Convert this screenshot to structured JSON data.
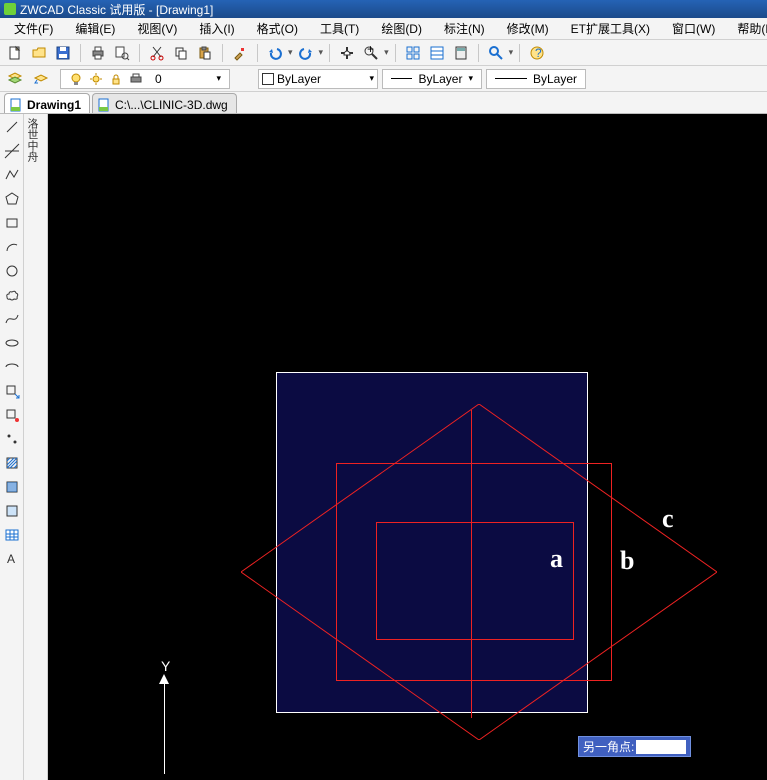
{
  "title": "ZWCAD Classic 试用版 - [Drawing1]",
  "menu": [
    "文件(F)",
    "编辑(E)",
    "视图(V)",
    "插入(I)",
    "格式(O)",
    "工具(T)",
    "绘图(D)",
    "标注(N)",
    "修改(M)",
    "ET扩展工具(X)",
    "窗口(W)",
    "帮助(H)"
  ],
  "tabs": [
    {
      "label": "Drawing1",
      "active": true
    },
    {
      "label": "C:\\...\\CLINIC-3D.dwg",
      "active": false
    }
  ],
  "layer_value": "0",
  "color_label": "ByLayer",
  "linetype_label": "ByLayer",
  "lineweight_label": "ByLayer",
  "prompt": "另一角点:",
  "annotations": {
    "a": "a",
    "b": "b",
    "c": "c"
  },
  "axis": "Y"
}
